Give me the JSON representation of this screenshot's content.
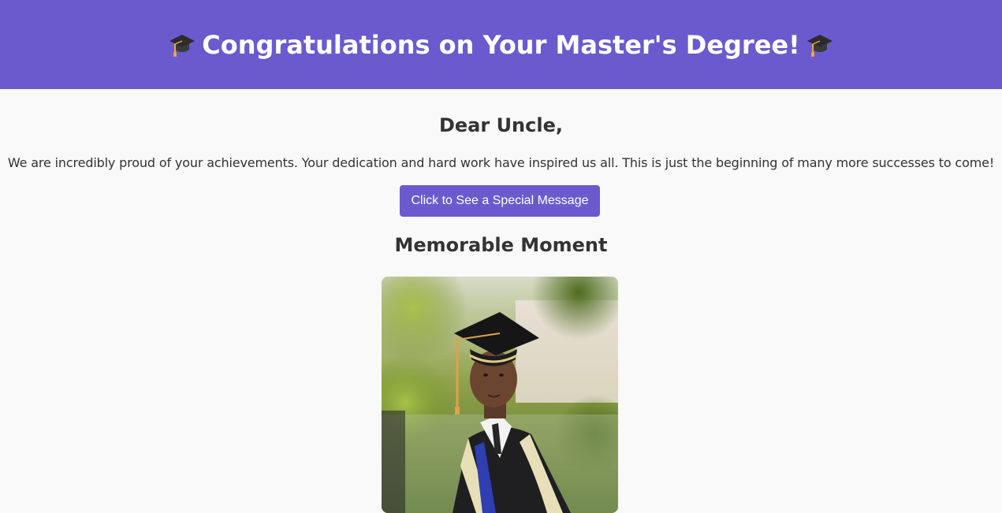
{
  "header": {
    "title": "Congratulations on Your Master's Degree!",
    "icon": "graduation-cap-icon",
    "background_color": "#6a5acd"
  },
  "main": {
    "greeting": "Dear Uncle,",
    "message": "We are incredibly proud of your achievements. Your dedication and hard work have inspired us all. This is just the beginning of many more successes to come!",
    "button_label": "Click to See a Special Message",
    "section_heading": "Memorable Moment",
    "photo": {
      "alt": "graduate-in-cap-and-gown-photo"
    }
  },
  "colors": {
    "accent": "#6a5acd",
    "page_background": "#f9f9f9",
    "text": "#333333"
  }
}
